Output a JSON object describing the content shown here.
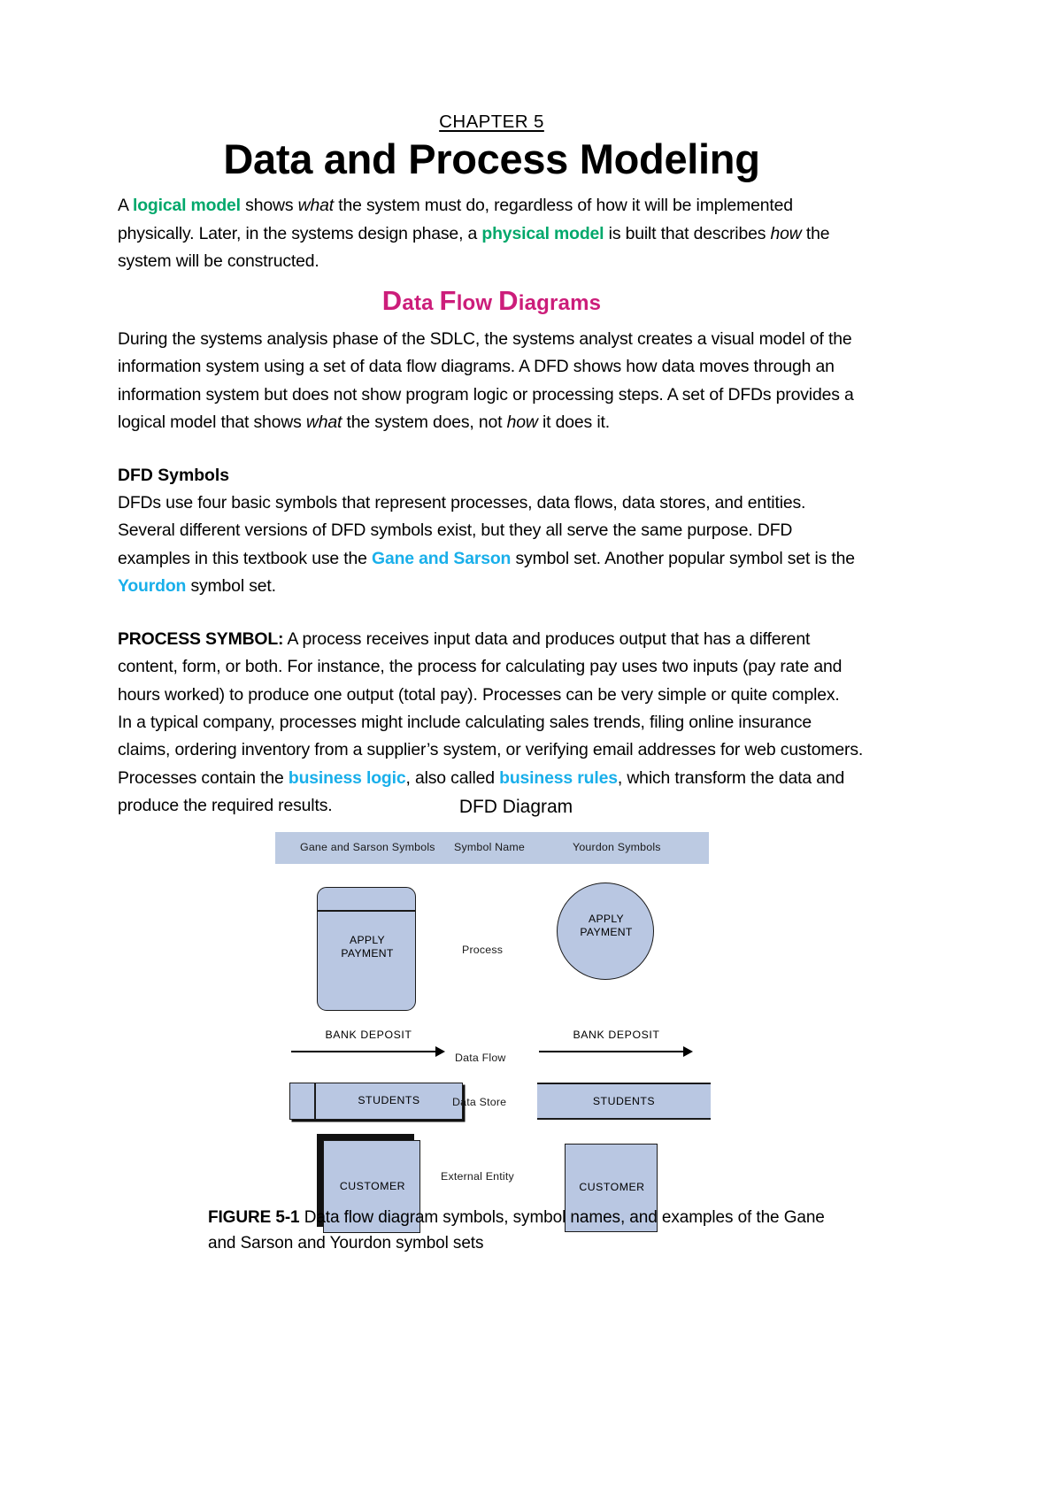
{
  "document": {
    "chapter_label": "CHAPTER 5",
    "title": "Data and Process Modeling",
    "intro": {
      "part1": "A ",
      "term1": "logical model",
      "part2": " shows ",
      "em1": "what",
      "part3": " the system must do, regardless of how it will be implemented physically. Later, in the systems design phase, a ",
      "term2": "physical model",
      "part4": " is built that describes ",
      "em2": "how",
      "part5": " the system will be constructed."
    },
    "section_heading": {
      "word1_cap": "D",
      "word1_rest": "ata ",
      "word2_cap": "F",
      "word2_rest": "low ",
      "word3_cap": "D",
      "word3_rest": "iagrams",
      "color": "#CC1D7A",
      "full_text": "Data Flow Diagrams"
    },
    "paragraph_dfd": {
      "part1": "During the systems analysis phase of the SDLC, the systems analyst creates a visual model of the information system using a set of data flow diagrams. A DFD shows how data moves through an information system but does not show program logic or processing steps. A set of DFDs provides a logical model that shows ",
      "em1": "what",
      "part2": " the system does, not ",
      "em2": "how",
      "part3": " it does it."
    },
    "subhead_symbols": "DFD Symbols",
    "paragraph_symbols": {
      "part1": "DFDs use four basic symbols that represent processes, data flows, data stores, and entities. Several different versions of DFD symbols exist, but they all serve the same purpose. DFD examples in this textbook use the ",
      "term1": "Gane and Sarson",
      "part2": " symbol set. Another popular symbol set is the ",
      "term2": "Yourdon",
      "part3": " symbol set."
    },
    "paragraph_process": {
      "lead": "PROCESS SYMBOL:",
      "part1": " A process receives input data and produces output that has a different content, form, or both. For instance, the process for calculating pay uses two inputs (pay rate and hours worked) to produce one output (total pay). Processes can be very simple or quite complex."
    },
    "paragraph_process2": {
      "part1": "In a typical company, processes might include calculating sales trends, filing online insurance claims, ordering inventory from a supplier’s system, or verifying email addresses for web customers. Processes contain the ",
      "term1": "business logic",
      "part2": ", also called ",
      "term2": "business rules",
      "part3": ", which transform the data and produce the required results."
    },
    "colors": {
      "green_term": "#00A86B",
      "cyan_term": "#19AFEA",
      "magenta_heading": "#CC1D7A",
      "figure_fill": "#B9C7E2",
      "figure_header_fill": "#BCCAE2"
    }
  },
  "figure": {
    "title": "DFD Diagram",
    "headers": {
      "left": "Gane and Sarson Symbols",
      "middle": "Symbol Name",
      "right": "Yourdon Symbols"
    },
    "rows": [
      {
        "symbol_name": "Process",
        "gane_label": "APPLY\nPAYMENT",
        "gane_label_line1": "APPLY",
        "gane_label_line2": "PAYMENT",
        "yourdon_label_line1": "APPLY",
        "yourdon_label_line2": "PAYMENT"
      },
      {
        "symbol_name": "Data Flow",
        "gane_label": "BANK DEPOSIT",
        "yourdon_label": "BANK DEPOSIT"
      },
      {
        "symbol_name": "Data Store",
        "gane_label": "STUDENTS",
        "yourdon_label": "STUDENTS"
      },
      {
        "symbol_name": "External Entity",
        "gane_label": "CUSTOMER",
        "yourdon_label": "CUSTOMER"
      }
    ],
    "caption": {
      "label": "FIGURE 5-1",
      "text": " Data flow diagram symbols, symbol names, and examples of the Gane and Sarson and Yourdon symbol sets"
    }
  }
}
